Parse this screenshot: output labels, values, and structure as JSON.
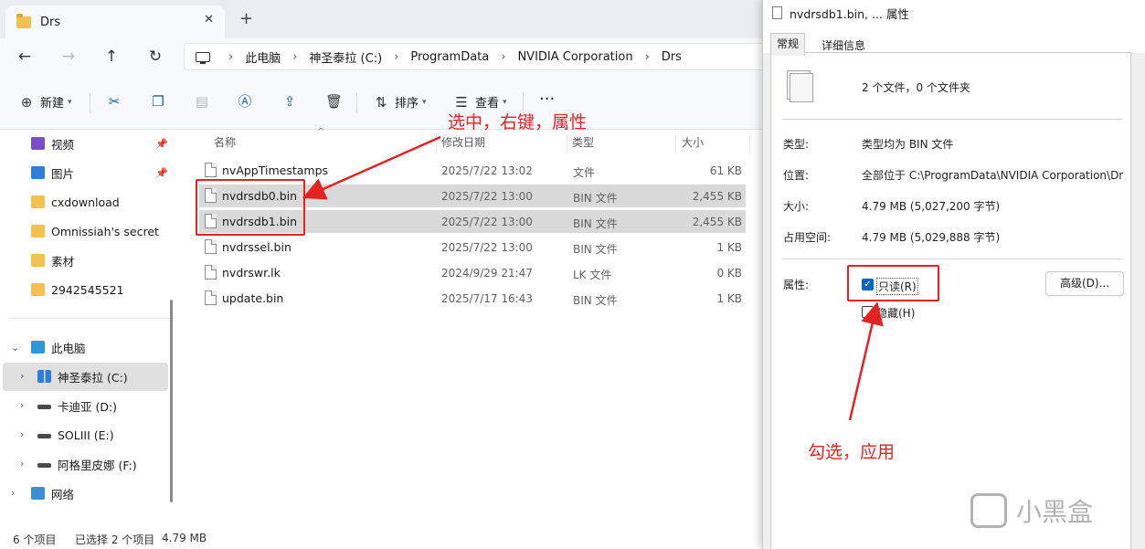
{
  "window": {
    "tab_title": "Drs",
    "tab_close": "✕",
    "new_tab": "+"
  },
  "nav": {
    "back": "←",
    "forward": "→",
    "up": "↑",
    "refresh": "↻",
    "breadcrumbs": [
      "此电脑",
      "神圣泰拉 (C:)",
      "ProgramData",
      "NVIDIA Corporation",
      "Drs"
    ]
  },
  "toolbar": {
    "new_label": "新建",
    "sort_label": "排序",
    "view_label": "查看",
    "more": "···"
  },
  "sidebar": {
    "quick": [
      "视频",
      "图片",
      "cxdownload",
      "Omnissiah's secret",
      "素材",
      "2942545521"
    ],
    "this_pc": "此电脑",
    "drives": [
      "神圣泰拉 (C:)",
      "卡迪亚 (D:)",
      "SOLIII (E:)",
      "阿格里皮娜 (F:)"
    ],
    "network": "网络"
  },
  "list": {
    "columns": [
      "名称",
      "修改日期",
      "类型",
      "大小"
    ],
    "rows": [
      {
        "name": "nvAppTimestamps",
        "date": "2025/7/22 13:02",
        "type": "文件",
        "size": "61 KB"
      },
      {
        "name": "nvdrsdb0.bin",
        "date": "2025/7/22 13:00",
        "type": "BIN 文件",
        "size": "2,455 KB"
      },
      {
        "name": "nvdrsdb1.bin",
        "date": "2025/7/22 13:00",
        "type": "BIN 文件",
        "size": "2,455 KB"
      },
      {
        "name": "nvdrssel.bin",
        "date": "2025/7/22 13:00",
        "type": "BIN 文件",
        "size": "1 KB"
      },
      {
        "name": "nvdrswr.lk",
        "date": "2024/9/29 21:47",
        "type": "LK 文件",
        "size": "0 KB"
      },
      {
        "name": "update.bin",
        "date": "2025/7/17 16:43",
        "type": "BIN 文件",
        "size": "1 KB"
      }
    ]
  },
  "status": {
    "count": "6 个项目",
    "selected": "已选择 2 个项目",
    "size": "4.79 MB"
  },
  "annotations": {
    "select_hint": "选中，右键，属性",
    "check_hint": "勾选，应用"
  },
  "dialog": {
    "title": "nvdrsdb1.bin, ... 属性",
    "tab_general": "常规",
    "tab_details": "详细信息",
    "summary": "2 个文件，0 个文件夹",
    "type_label": "类型:",
    "type_value": "类型均为 BIN 文件",
    "location_label": "位置:",
    "location_value": "全部位于 C:\\ProgramData\\NVIDIA Corporation\\Dr",
    "size_label": "大小:",
    "size_value": "4.79 MB (5,027,200 字节)",
    "disk_label": "占用空间:",
    "disk_value": "4.79 MB (5,029,888 字节)",
    "attr_label": "属性:",
    "readonly_label": "只读(R)",
    "hidden_label": "隐藏(H)",
    "advanced_label": "高级(D)..."
  },
  "watermark": "小黑盒",
  "colors": {
    "annotation_red": "#e32222",
    "accent_blue": "#0067c0",
    "selection_gray": "#d9d9d9"
  }
}
